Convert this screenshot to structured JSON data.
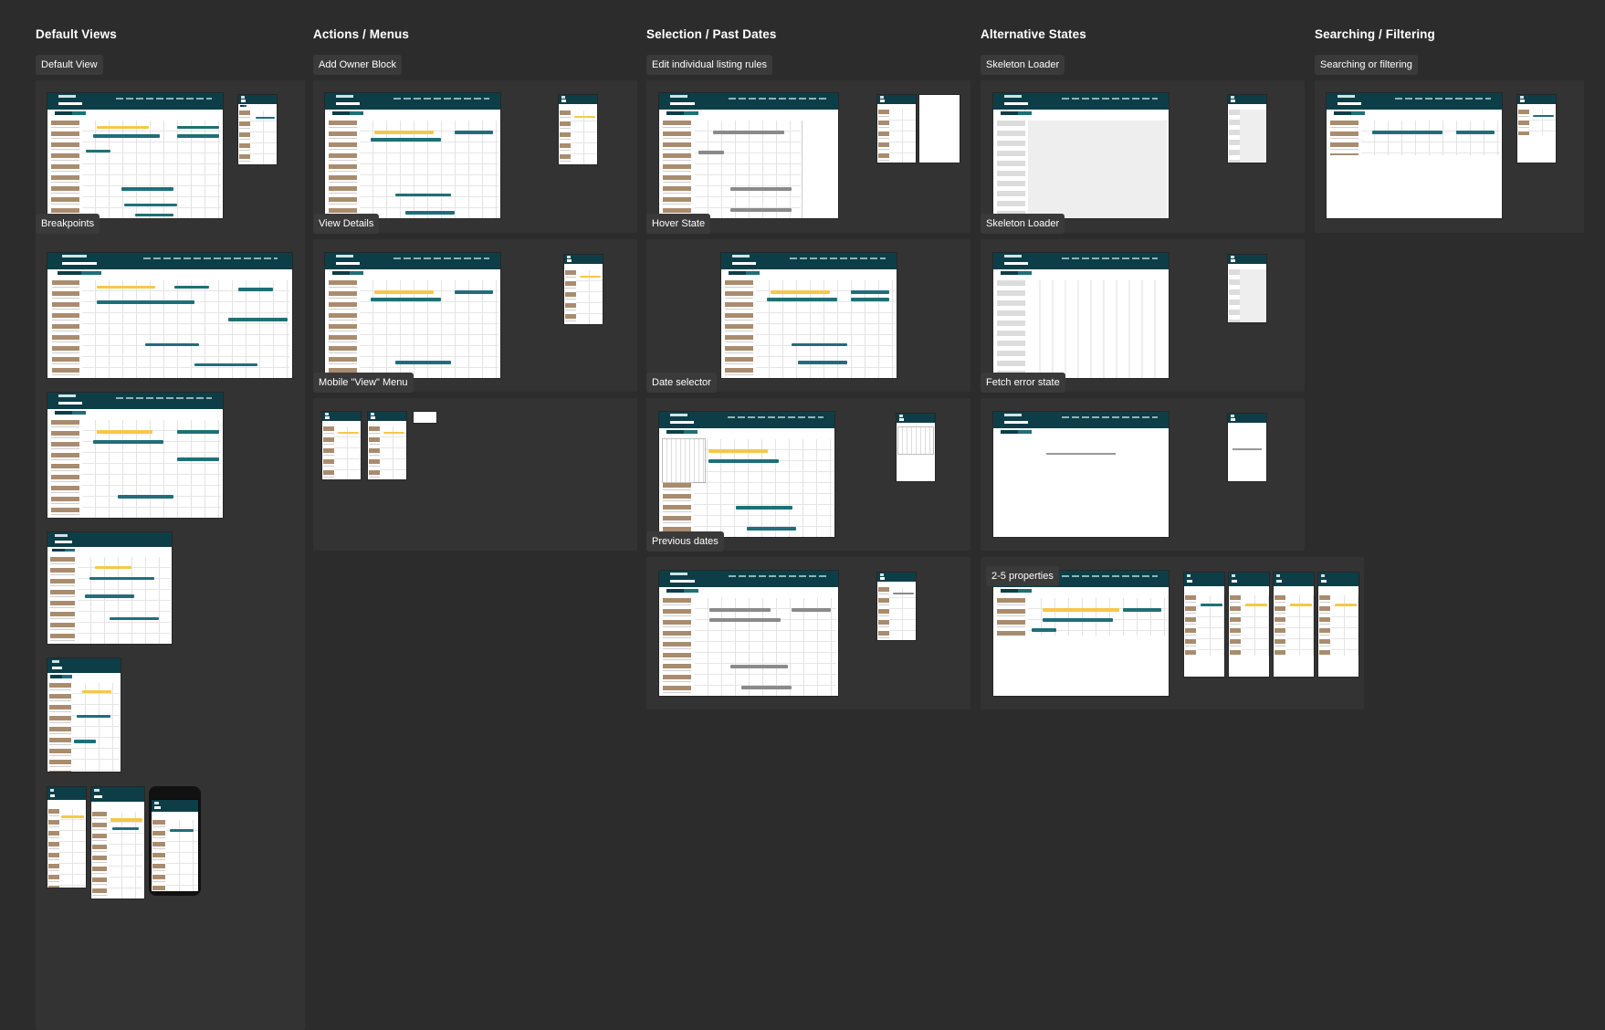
{
  "sections": {
    "default_views": "Default Views",
    "actions_menus": "Actions / Menus",
    "selection_past_dates": "Selection / Past Dates",
    "alternative_states": "Alternative States",
    "searching_filtering": "Searching / Filtering"
  },
  "frame_labels": {
    "default_view": "Default View",
    "breakpoints": "Breakpoints",
    "add_owner_block": "Add Owner Block",
    "view_details": "View Details",
    "mobile_view_menu": "Mobile \"View\" Menu",
    "edit_listing_rules": "Edit individual listing rules",
    "hover_state": "Hover State",
    "date_selector": "Date selector",
    "previous_dates": "Previous dates",
    "skeleton_loader_1": "Skeleton Loader",
    "skeleton_loader_2": "Skeleton Loader",
    "fetch_error_state": "Fetch error state",
    "two_five_properties": "2-5 properties",
    "searching_or_filtering": "Searching or filtering"
  },
  "colors": {
    "canvas": "#2c2c2c",
    "panel": "#333333",
    "header_teal": "#0d3e47",
    "booking_teal": "#1f6f78",
    "booking_yellow": "#f4c84a",
    "past_grey": "#8a8a8a"
  }
}
